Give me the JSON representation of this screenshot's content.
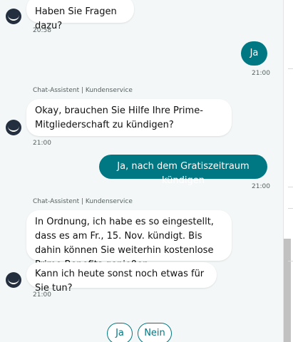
{
  "messages": [
    {
      "role": "assistant",
      "text": "Haben Sie Fragen dazu?",
      "time": "20:58"
    },
    {
      "role": "user",
      "text": "Ja",
      "time": "21:00"
    },
    {
      "role": "assistant",
      "sender": "Chat-Assistent | Kundenservice",
      "text": "Okay, brauchen Sie Hilfe Ihre Prime-Mitgliederschaft zu kündigen?",
      "time": "21:00"
    },
    {
      "role": "user",
      "text": "Ja, nach dem Gratiszeitraum kündigen",
      "time": "21:00"
    },
    {
      "role": "assistant",
      "sender": "Chat-Assistent | Kundenservice",
      "text": "In Ordnung, ich habe es so eingestellt, dass es am Fr., 15. Nov. kündigt. Bis dahin können Sie weiterhin kostenlose Prime-Benefits genießen."
    },
    {
      "role": "assistant",
      "text": "Kann ich heute sonst noch etwas für Sie tun?",
      "time": "21:00"
    }
  ],
  "quick_replies": [
    {
      "label": "Ja"
    },
    {
      "label": "Nein"
    }
  ],
  "colors": {
    "accent": "#007883",
    "panel_background": "#f4f7f7",
    "avatar": "#232f3e"
  },
  "icons": {
    "assistant_avatar": "smile-logo-icon"
  }
}
